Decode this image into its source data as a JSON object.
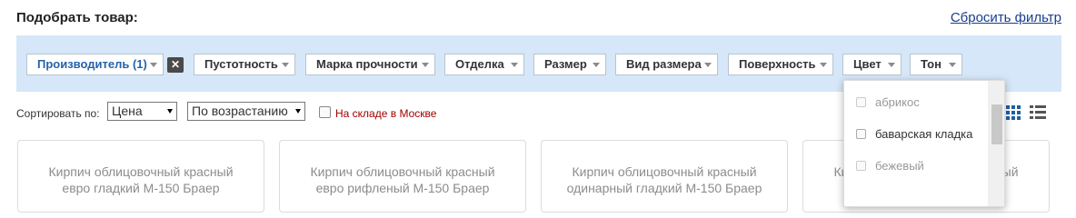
{
  "header": {
    "title": "Подобрать товар:",
    "reset_link": "Сбросить фильтр"
  },
  "filters": [
    {
      "label": "Производитель (1)",
      "active": true
    },
    {
      "label": "Пустотность",
      "active": false
    },
    {
      "label": "Марка прочности",
      "active": false
    },
    {
      "label": "Отделка",
      "active": false
    },
    {
      "label": "Размер",
      "active": false
    },
    {
      "label": "Вид размера",
      "active": false
    },
    {
      "label": "Поверхность",
      "active": false
    },
    {
      "label": "Цвет",
      "active": false
    },
    {
      "label": "Тон",
      "active": false
    }
  ],
  "clear_filter_icon": "close-icon",
  "clear_filter_glyph": "✕",
  "sort": {
    "label": "Сортировать по:",
    "field_value": "Цена",
    "order_value": "По возрастанию",
    "in_stock_label": "На складе в Москве",
    "in_stock_checked": false
  },
  "view_modes": [
    "grid-view-icon",
    "list-view-icon"
  ],
  "products": [
    {
      "name_line1": "Кирпич облицовочный красный",
      "name_line2": "евро гладкий М-150 Браер"
    },
    {
      "name_line1": "Кирпич облицовочный красный",
      "name_line2": "евро рифленый М-150 Браер"
    },
    {
      "name_line1": "Кирпич облицовочный красный",
      "name_line2": "одинарный гладкий М-150 Браер"
    },
    {
      "name_line1": "Кирпич облицовочный красный",
      "name_line2": ""
    }
  ],
  "color_dropdown": {
    "items": [
      {
        "label": "абрикос",
        "enabled": false
      },
      {
        "label": "баварская кладка",
        "enabled": true
      },
      {
        "label": "бежевый",
        "enabled": false
      }
    ]
  },
  "colors": {
    "filter_bg": "#d5e7f8",
    "link": "#1a3e8c",
    "active_filter": "#2563a8",
    "stock_text": "#a00000",
    "view_icon_active": "#1f5fa0",
    "view_icon_inactive": "#555555"
  }
}
